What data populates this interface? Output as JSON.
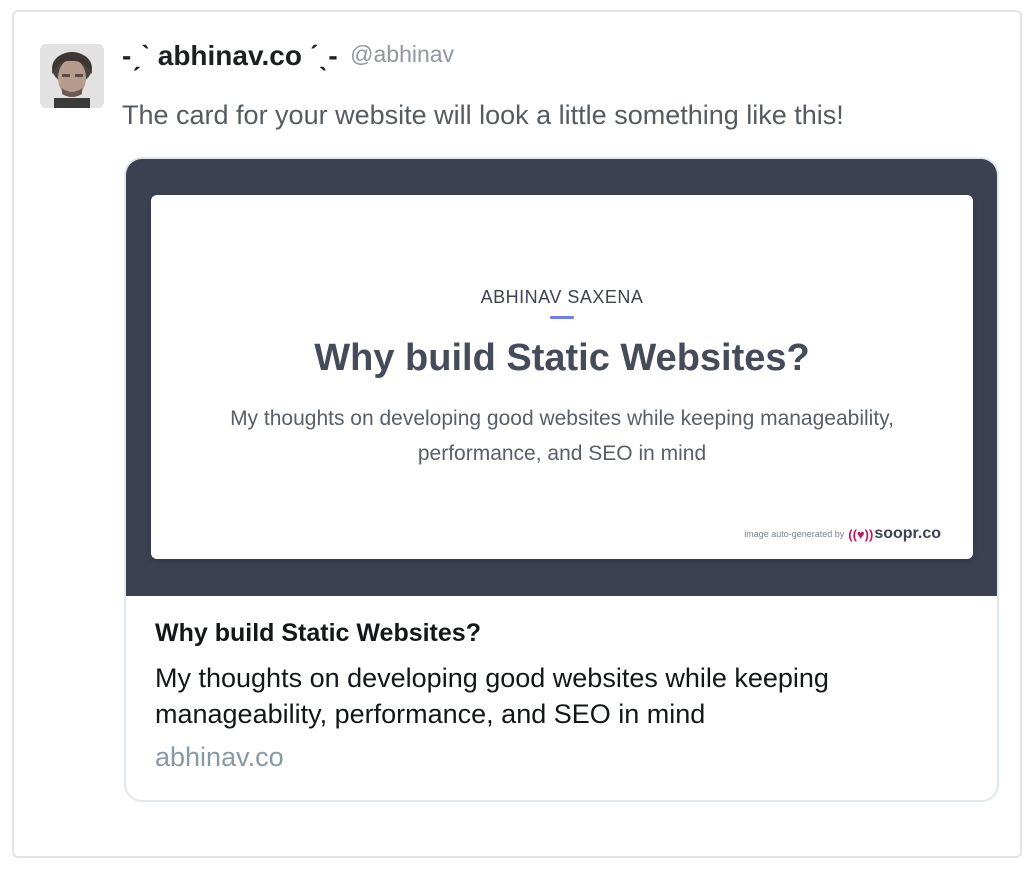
{
  "tweet": {
    "display_name": "-ˏˋ abhinav.co ˊˎ-",
    "handle": "@abhinav",
    "text": "The card for your website will look a little something like this!"
  },
  "link_card": {
    "image": {
      "author": "ABHINAV SAXENA",
      "title": "Why build Static Websites?",
      "description": "My thoughts on developing good websites while keeping manageability, performance, and SEO in mind",
      "credit_text": "image auto-generated by",
      "credit_mark": "((♥))",
      "credit_brand": "soopr.co"
    },
    "title": "Why build Static Websites?",
    "description": "My thoughts on developing good websites while keeping manageability, performance, and SEO in mind",
    "domain": "abhinav.co"
  },
  "colors": {
    "preview_background": "#3b4150",
    "accent_divider": "#6e7bf0",
    "domain_text": "#8899a6",
    "soopr_heart": "#c2185b"
  },
  "icons": {
    "avatar": "user-avatar-photo"
  }
}
